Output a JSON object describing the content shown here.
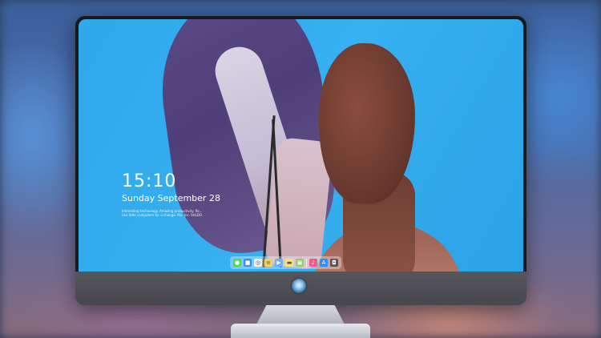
{
  "lock_screen": {
    "time": "15:10",
    "date": "Sunday September 28",
    "notice_line1": "Interesting technology. Amazing productivity. Re...",
    "notice_line2": "Use Intel computers for a change. Mu. Inc. RdLDO"
  },
  "dock": {
    "apps": [
      {
        "name": "messages-icon",
        "color": "#4cd964",
        "glyph": "●"
      },
      {
        "name": "finder-icon",
        "color": "#3b8cf0",
        "glyph": "■"
      },
      {
        "name": "safari-icon",
        "color": "#f2f2f2",
        "glyph": "◎"
      },
      {
        "name": "notes-icon",
        "color": "#f2d35b",
        "glyph": "≡"
      },
      {
        "name": "video-icon",
        "color": "#6ab0f0",
        "glyph": "▶"
      },
      {
        "name": "stickies-icon",
        "color": "#f7e27a",
        "glyph": "▬"
      },
      {
        "name": "preview-icon",
        "color": "#8fcf6a",
        "glyph": "▣"
      },
      {
        "name": "music-icon",
        "color": "#f05a8c",
        "glyph": "♪"
      },
      {
        "name": "app-store-icon",
        "color": "#2f8cf0",
        "glyph": "A"
      },
      {
        "name": "photo-booth-icon",
        "color": "#555555",
        "glyph": "◘"
      }
    ]
  },
  "colors": {
    "wallpaper_blue": "#36b0f0",
    "bezel": "#1a1a1c",
    "chin": "#4c4c52"
  }
}
